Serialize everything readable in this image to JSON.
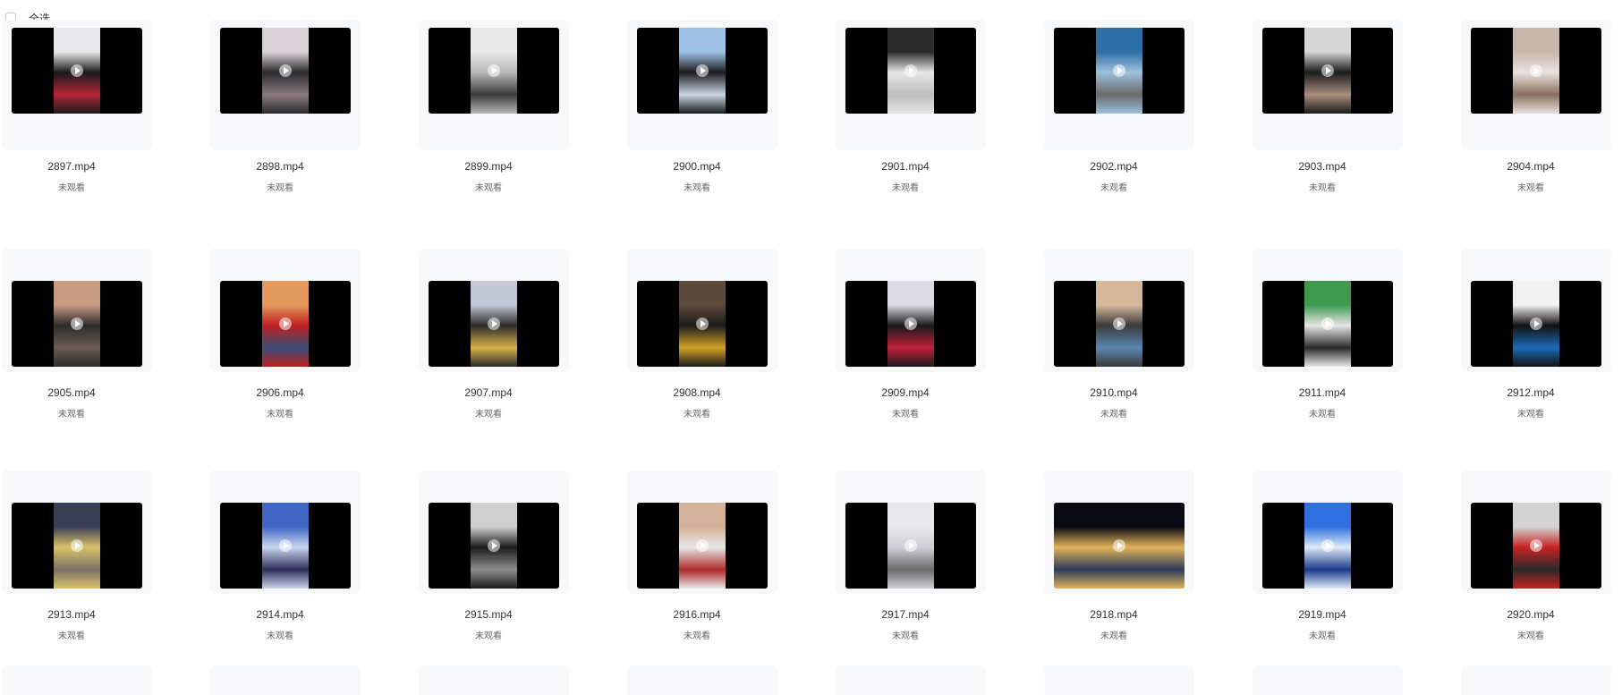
{
  "select_all_label": "全选",
  "status_text": "未观看",
  "files": [
    {
      "name": "2897.mp4",
      "colors": [
        "#e8e8ea",
        "#1a1a1a",
        "#b4253a"
      ]
    },
    {
      "name": "2898.mp4",
      "colors": [
        "#d9d2d6",
        "#2b2b2e",
        "#8a7a80"
      ]
    },
    {
      "name": "2899.mp4",
      "colors": [
        "#e9e9e9",
        "#b7b7b7",
        "#3b3b3b"
      ]
    },
    {
      "name": "2900.mp4",
      "colors": [
        "#9fc3e8",
        "#1b1b1b",
        "#c9d6e4"
      ]
    },
    {
      "name": "2901.mp4",
      "colors": [
        "#2b2b2b",
        "#e6e6e6",
        "#bdbdbd"
      ]
    },
    {
      "name": "2902.mp4",
      "colors": [
        "#2d6fa8",
        "#9ec0dc",
        "#6a6a6a"
      ]
    },
    {
      "name": "2903.mp4",
      "colors": [
        "#d6d6d6",
        "#1a1a1a",
        "#a98f7f"
      ]
    },
    {
      "name": "2904.mp4",
      "colors": [
        "#c9b6ab",
        "#e8e2de",
        "#8b6f5f"
      ]
    },
    {
      "name": "2905.mp4",
      "colors": [
        "#c89b82",
        "#2c2c2c",
        "#6b5c52"
      ]
    },
    {
      "name": "2906.mp4",
      "colors": [
        "#e39a5c",
        "#bf1f1f",
        "#3a4f7a"
      ]
    },
    {
      "name": "2907.mp4",
      "colors": [
        "#c3c7d6",
        "#2a2a2a",
        "#d7b24a"
      ]
    },
    {
      "name": "2908.mp4",
      "colors": [
        "#5c4a3b",
        "#1b1b1b",
        "#d1a125"
      ]
    },
    {
      "name": "2909.mp4",
      "colors": [
        "#d9dbe5",
        "#1a1a1a",
        "#c01f3a"
      ]
    },
    {
      "name": "2910.mp4",
      "colors": [
        "#d5b89c",
        "#3a3a3a",
        "#5a86b2"
      ]
    },
    {
      "name": "2911.mp4",
      "colors": [
        "#3e9a4d",
        "#e6e6e6",
        "#2a2a2a"
      ]
    },
    {
      "name": "2912.mp4",
      "colors": [
        "#f2f2f2",
        "#111111",
        "#1c6bb8"
      ]
    },
    {
      "name": "2913.mp4",
      "colors": [
        "#3a3e55",
        "#d9c36a",
        "#7b6f66"
      ]
    },
    {
      "name": "2914.mp4",
      "colors": [
        "#3f66c4",
        "#c9d6ee",
        "#2d2d5a"
      ]
    },
    {
      "name": "2915.mp4",
      "colors": [
        "#cfcfcf",
        "#1a1a1a",
        "#8e8e8e"
      ]
    },
    {
      "name": "2916.mp4",
      "colors": [
        "#d4b19a",
        "#e7e7e7",
        "#b02a2a"
      ]
    },
    {
      "name": "2917.mp4",
      "colors": [
        "#e7e7ea",
        "#cfcfd6",
        "#6a6a6a"
      ]
    },
    {
      "name": "2918.mp4",
      "colors": [
        "#0a0a14",
        "#e3b45a",
        "#2b3a5a"
      ],
      "wide": true
    },
    {
      "name": "2919.mp4",
      "colors": [
        "#2f6fe0",
        "#dfeaf8",
        "#1a3a8a"
      ]
    },
    {
      "name": "2920.mp4",
      "colors": [
        "#d3d3d3",
        "#c62222",
        "#2a2a2a"
      ]
    }
  ]
}
